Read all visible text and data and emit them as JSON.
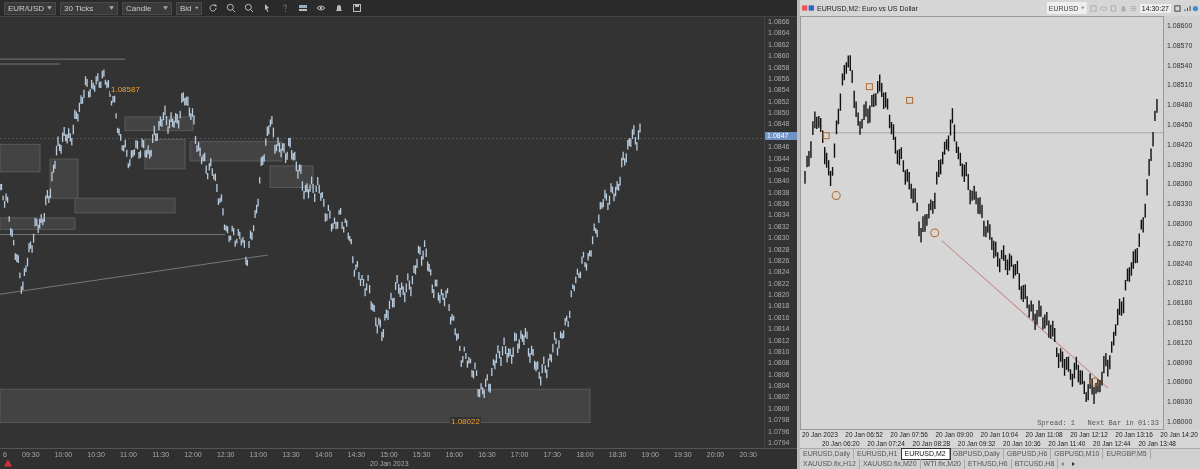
{
  "left_chart": {
    "toolbar": {
      "symbol": "EUR/USD",
      "interval": "30 Ticks",
      "chart_type": "Candle",
      "price_side": "Bid"
    },
    "annotations": [
      {
        "kind": "high",
        "text": "1.08587"
      },
      {
        "kind": "low",
        "text": "1.08022"
      }
    ],
    "current_price": "1.0847",
    "price_axis": [
      "1.0866",
      "1.0864",
      "1.0862",
      "1.0860",
      "1.0858",
      "1.0856",
      "1.0854",
      "1.0852",
      "1.0850",
      "1.0848",
      "1.0846",
      "1.0844",
      "1.0842",
      "1.0840",
      "1.0838",
      "1.0836",
      "1.0834",
      "1.0832",
      "1.0830",
      "1.0828",
      "1.0826",
      "1.0824",
      "1.0822",
      "1.0820",
      "1.0818",
      "1.0816",
      "1.0814",
      "1.0812",
      "1.0810",
      "1.0808",
      "1.0806",
      "1.0804",
      "1.0802",
      "1.0800",
      "1.0798",
      "1.0796",
      "1.0794"
    ],
    "time_axis": [
      "6",
      "09:30",
      "10:00",
      "10:30",
      "11:00",
      "11:30",
      "12:00",
      "12:30",
      "13:00",
      "13:30",
      "14:00",
      "14:30",
      "15:00",
      "15:30",
      "16:00",
      "16:30",
      "17:00",
      "17:30",
      "18:00",
      "18:30",
      "19:00",
      "19:30",
      "20:00",
      "20:30"
    ],
    "date_label": "20 Jan 2023"
  },
  "right_chart": {
    "title": "EURUSD,M2: Euro vs US Dollar",
    "symbol": "EURUSD",
    "clock": "14:30:27",
    "status": "Spread: 1   Next Bar in 01:33",
    "price_axis": [
      "1.08600",
      "1.08570",
      "1.08540",
      "1.08510",
      "1.08480",
      "1.08450",
      "1.08420",
      "1.08390",
      "1.08360",
      "1.08330",
      "1.08300",
      "1.08270",
      "1.08240",
      "1.08210",
      "1.08180",
      "1.08150",
      "1.08120",
      "1.08090",
      "1.08060",
      "1.08030",
      "1.08000"
    ],
    "time_axis": [
      "20 Jan 2023",
      "20 Jan 06:20",
      "20 Jan 06:52",
      "20 Jan 07:24",
      "20 Jan 07:56",
      "20 Jan 08:28",
      "20 Jan 09:00",
      "20 Jan 09:32",
      "20 Jan 10:04",
      "20 Jan 10:36",
      "20 Jan 11:08",
      "20 Jan 11:40",
      "20 Jan 12:12",
      "20 Jan 12:44",
      "20 Jan 13:16",
      "20 Jan 13:48",
      "20 Jan 14:20"
    ]
  },
  "tabs": [
    {
      "label": "EURUSD,Daily",
      "selected": false
    },
    {
      "label": "EURUSD,H1",
      "selected": false
    },
    {
      "label": "EURUSD,M2",
      "selected": true
    },
    {
      "label": "GBPUSD,Daily",
      "selected": false
    },
    {
      "label": "GBPUSD,H6",
      "selected": false
    },
    {
      "label": "GBPUSD,M10",
      "selected": false
    },
    {
      "label": "EURGBP,M5",
      "selected": false
    },
    {
      "label": "XAUUSD.fix,H12",
      "selected": false
    },
    {
      "label": "XAUUSD.fix,M20",
      "selected": false
    },
    {
      "label": "WTI.fix,M20",
      "selected": false
    },
    {
      "label": "ETHUSD,H6",
      "selected": false
    },
    {
      "label": "BTCUSD,H8",
      "selected": false
    }
  ]
}
